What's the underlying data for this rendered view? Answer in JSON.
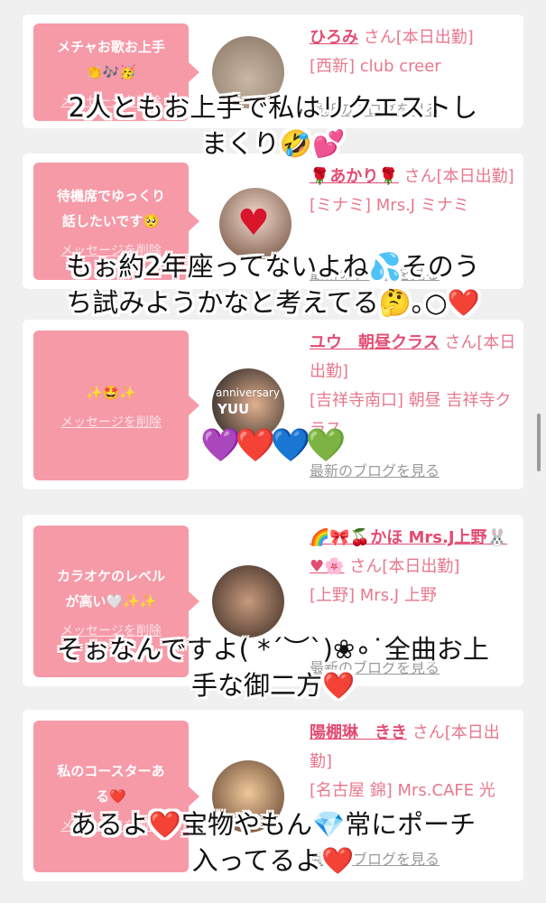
{
  "cards": [
    {
      "bubble_line1": "メチャお歌お上手",
      "bubble_line2": "👏🎶🥳",
      "delete_label": "メッセージを削除",
      "name": "ひろみ",
      "suffix": "さん[本日出勤]",
      "shop": "[西新] club creer",
      "blog": "最新のブログを見る"
    },
    {
      "bubble_line1": "待機席でゆっくり",
      "bubble_line2": "話したいです🥺",
      "delete_label": "メッセージを削除",
      "name": "🌹あかり🌹",
      "suffix": "さん[本日出勤]",
      "shop": "[ミナミ] Mrs.J ミナミ",
      "blog": "最新のブログを見る"
    },
    {
      "bubble_line1": "✨🤩✨",
      "bubble_line2": "",
      "delete_label": "メッセージを削除",
      "name": "ユウ　朝昼クラス",
      "suffix": "さん[本日出勤]",
      "shop": "[吉祥寺南口] 朝昼 吉祥寺クラス",
      "blog": "最新のブログを見る",
      "avatar_text_1": "anniversary",
      "avatar_text_2": "YUU"
    },
    {
      "bubble_line1": "カラオケのレベル",
      "bubble_line2": "が高い🤍✨✨",
      "delete_label": "メッセージを削除",
      "name": "🌈🎀🍒かほ Mrs.J上野🐰♥🌸",
      "suffix": "さん[本日出勤]",
      "shop": "[上野] Mrs.J 上野",
      "blog": "最新のブログを見る"
    },
    {
      "bubble_line1": "私のコースターあ",
      "bubble_line2": "る❤️",
      "delete_label": "メッセージを削除",
      "name": "陽棚琳　きき",
      "suffix": "さん[本日出勤]",
      "shop": "[名古屋 錦] Mrs.CAFE 光",
      "blog": "最新のブログを見る"
    }
  ],
  "overlays": [
    "2人ともお上手で私はリクエストし",
    "まくり🤣💕",
    "もぉ約2年座ってないよね💦そのう",
    "ち試みようかなと考えてる🤔｡○❤️",
    "そぉなんですよ( *´︶`)❀∘˙全曲お上",
    "手な御二方❤️",
    "あるよ❤️宝物やもん💎常にポーチ",
    "入ってるよ❤️"
  ],
  "hearts": "💜❤️💙💚",
  "colors": {
    "bubble": "#f69aa8",
    "name": "#e24d73",
    "text": "#e8788d"
  }
}
